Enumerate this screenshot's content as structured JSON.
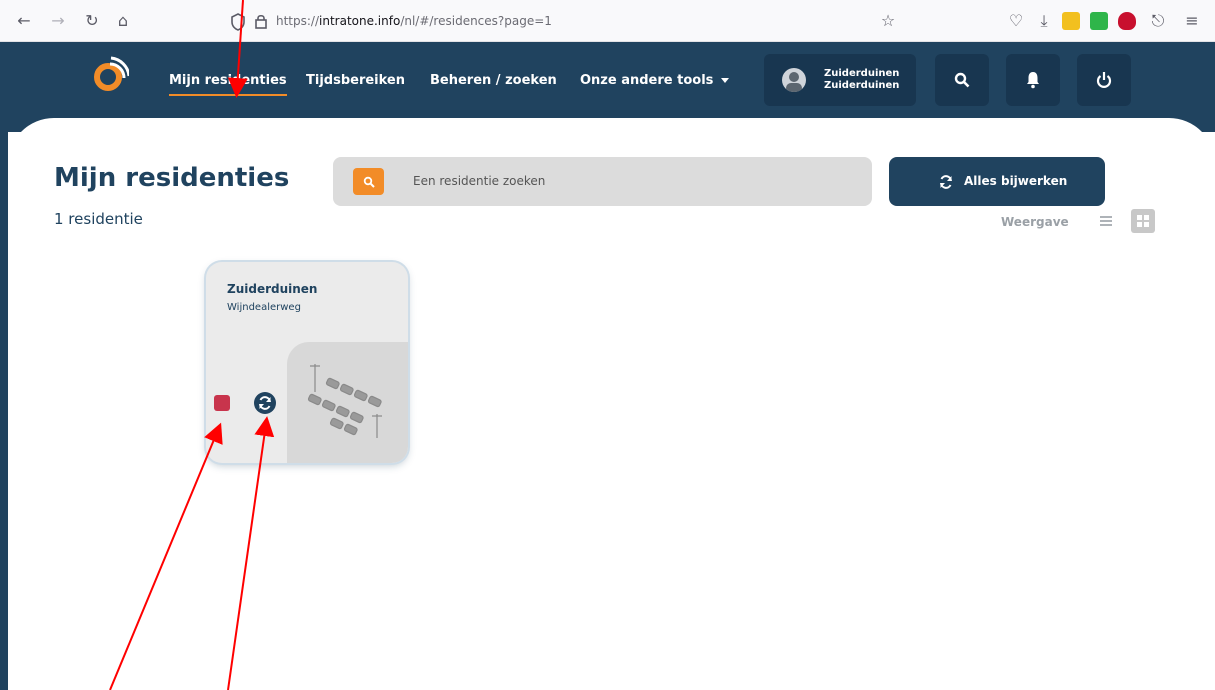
{
  "browser": {
    "url_prefix": "https://",
    "url_domain": "intratone.info",
    "url_path": "/nl/#/residences?page=1"
  },
  "header": {
    "nav": [
      {
        "label": "Mijn residenties"
      },
      {
        "label": "Tijdsbereiken"
      },
      {
        "label": "Beheren / zoeken"
      },
      {
        "label": "Onze andere tools"
      }
    ],
    "user": {
      "line1": "Zuiderduinen",
      "line2": "Zuiderduinen"
    }
  },
  "page": {
    "title": "Mijn residenties",
    "count": "1 residentie",
    "search_placeholder": "Een residentie zoeken",
    "update_label": "Alles bijwerken",
    "view_label": "Weergave"
  },
  "residences": [
    {
      "name": "Zuiderduinen",
      "street": "Wijndealerweg"
    }
  ],
  "colors": {
    "brand_navy": "#20435f",
    "accent_orange": "#f28c28",
    "status_red": "#c8344c",
    "annotation_red": "#ff0000"
  }
}
